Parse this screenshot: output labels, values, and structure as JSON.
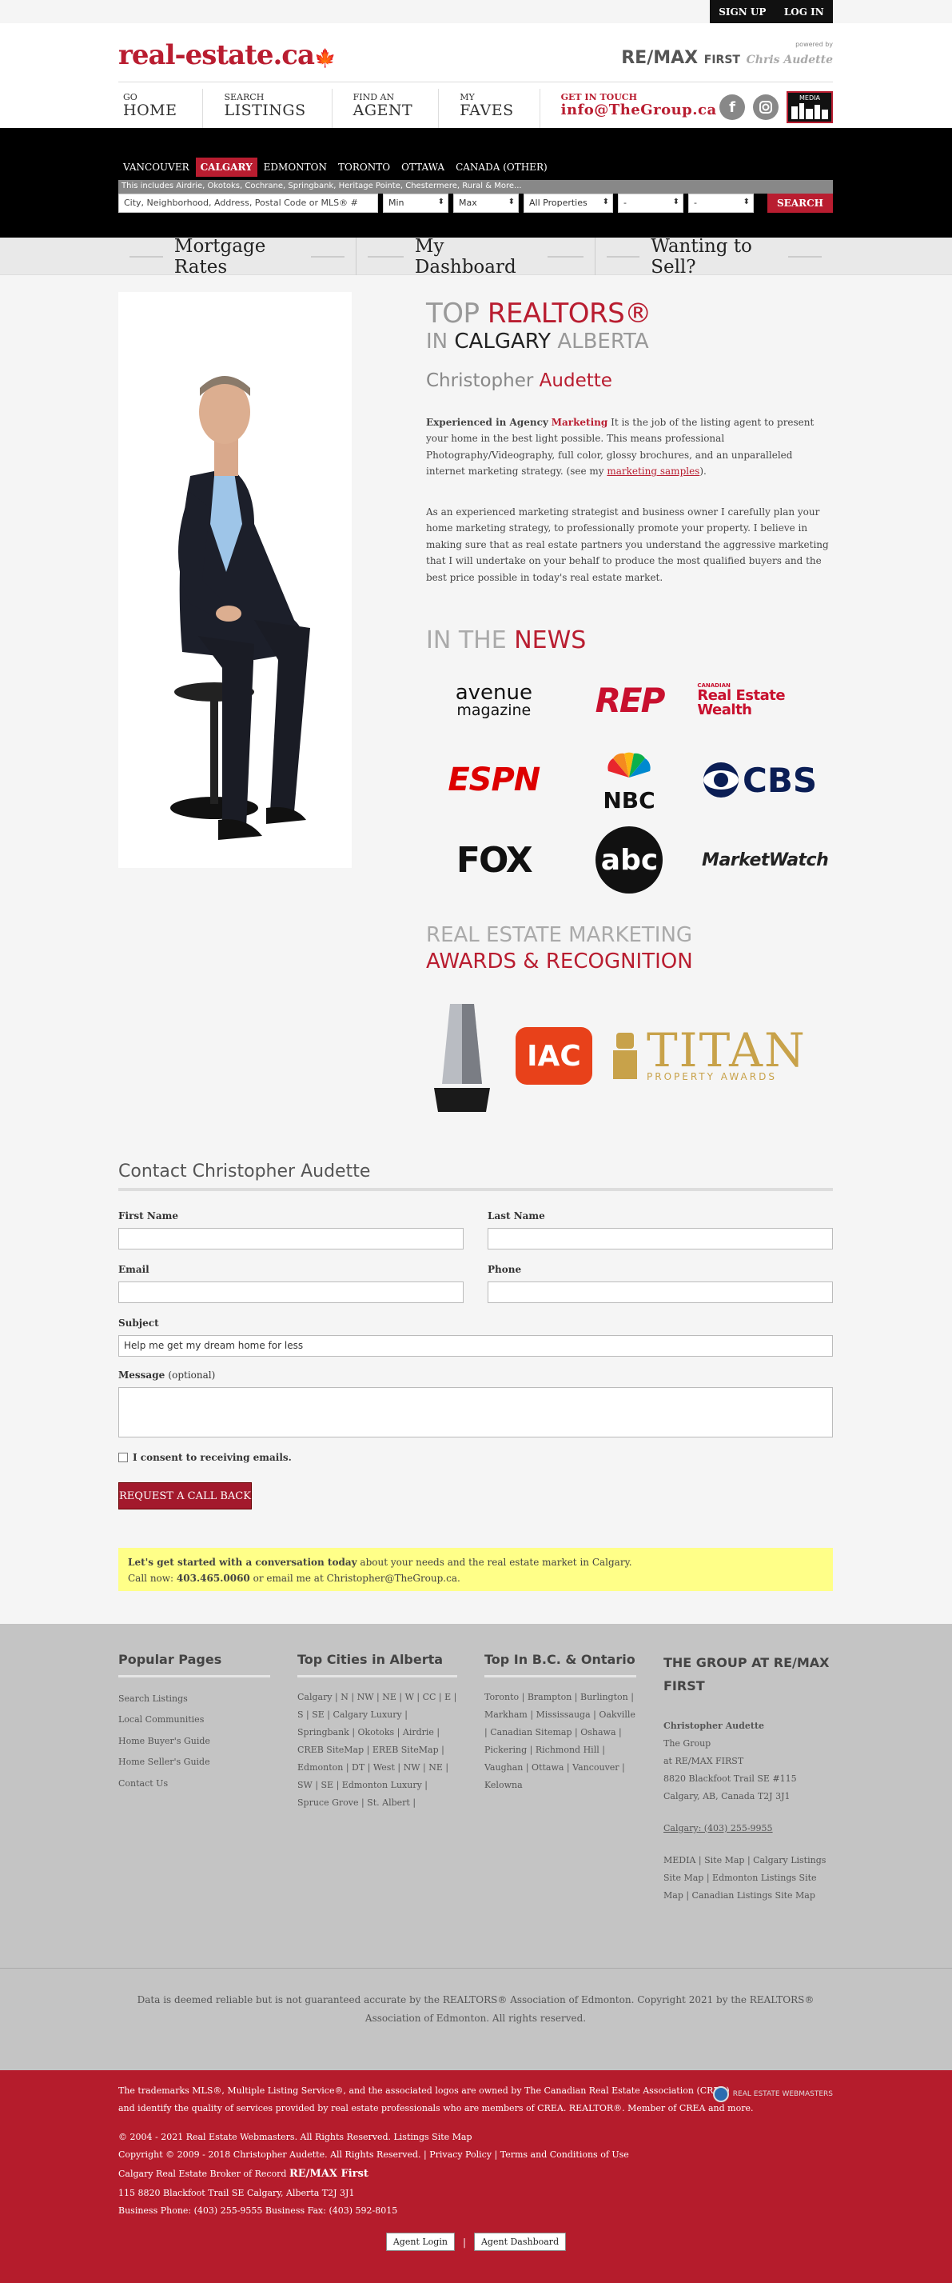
{
  "topbar": {
    "signup": "SIGN UP",
    "login": "LOG IN"
  },
  "header": {
    "logo": "real-estate.ca",
    "powered": "powered by",
    "brand": "RE/MAX",
    "brand_sub": "FIRST",
    "signature": "Chris Audette"
  },
  "nav": [
    {
      "small": "GO",
      "large": "HOME"
    },
    {
      "small": "SEARCH",
      "large": "LISTINGS"
    },
    {
      "small": "FIND AN",
      "large": "AGENT"
    },
    {
      "small": "MY",
      "large": "FAVES"
    }
  ],
  "contact_nav": {
    "small": "Get in Touch",
    "large": "info@TheGroup.ca"
  },
  "media_badge": "MEDIA",
  "cities": [
    "VANCOUVER",
    "CALGARY",
    "EDMONTON",
    "TORONTO",
    "OTTAWA",
    "CANADA (OTHER)"
  ],
  "search": {
    "hint": "This includes Airdrie, Okotoks, Cochrane, Springbank, Heritage Pointe, Chestermere, Rural & More...",
    "placeholder": "City, Neighborhood, Address, Postal Code or MLS® #",
    "min": "Min",
    "max": "Max",
    "type": "All Properties",
    "beds": "-",
    "baths": "-",
    "button": "SEARCH"
  },
  "subnav": [
    "Mortgage Rates",
    "My Dashboard",
    "Wanting to Sell?"
  ],
  "hero": {
    "top": "TOP",
    "realtors": "REALTORS®",
    "in": "IN",
    "city": "CALGARY",
    "province": "ALBERTA",
    "first": "Christopher",
    "last": "Audette"
  },
  "para1": {
    "lead": "Experienced in Agency",
    "lead_red": "Marketing",
    "body": " It is the job of the listing agent to present your home in the best light possible. This means professional Photography/Videography, full color, glossy brochures, and an unparalleled internet marketing strategy. (see my ",
    "link": "marketing samples",
    "end": ")."
  },
  "para2": "As an experienced marketing strategist and business owner I carefully plan your home marketing strategy, to professionally promote your property. I believe in making sure that as real estate partners you understand the aggressive marketing that I will undertake on your behalf to produce the most qualified buyers and the best price possible in today's real estate market.",
  "news": {
    "in_the": "IN THE",
    "news": "NEWS"
  },
  "news_logos": [
    "avenue",
    "magazine",
    "REP",
    "Real Estate Wealth",
    "ESPN",
    "NBC",
    "CBS",
    "FOX",
    "abc",
    "MarketWatch",
    "CANADIAN"
  ],
  "awards": {
    "line1": "REAL ESTATE MARKETING",
    "line2": "AWARDS & RECOGNITION",
    "iac": "IAC",
    "titan": "TITAN",
    "titan_sub": "PROPERTY AWARDS"
  },
  "contact": {
    "title": "Contact Christopher Audette",
    "first": "First Name",
    "last": "Last Name",
    "email": "Email",
    "phone": "Phone",
    "subject": "Subject",
    "subject_value": "Help me get my dream home for less",
    "message": "Message",
    "optional": "(optional)",
    "consent": "I consent to receiving emails.",
    "button": "REQUEST A CALL BACK"
  },
  "cta": {
    "bold": "Let's get started with a conversation today",
    "rest": " about your needs and the real estate market in Calgary.",
    "call": "Call now: ",
    "phone": "403.465.0060",
    "email": " or email me at Christopher@TheGroup.ca."
  },
  "footer": {
    "popular_title": "Popular Pages",
    "popular": [
      "Search Listings",
      "Local Communities",
      "Home Buyer's Guide",
      "Home Seller's Guide",
      "Contact Us"
    ],
    "alberta_title": "Top Cities in Alberta",
    "alberta": "Calgary | N | NW | NE | W | CC | E | S | SE | Calgary Luxury | Springbank | Okotoks | Airdrie | CREB SiteMap | EREB SiteMap | Edmonton | DT | West | NW | NE | SW | SE | Edmonton Luxury | Spruce Grove | St. Albert |",
    "bc_title": "Top In B.C. & Ontario",
    "bc": "Toronto | Brampton | Burlington | Markham | Mississauga | Oakville | Canadian Sitemap | Oshawa | Pickering | Richmond Hill | Vaughan | Ottawa | Vancouver | Kelowna",
    "group_title": "THE GROUP AT RE/MAX FIRST",
    "group_name": "Christopher Audette",
    "group_lines": [
      "The Group",
      "at RE/MAX FIRST",
      "8820 Blackfoot Trail SE #115",
      "Calgary, AB, Canada T2J 3J1"
    ],
    "group_phone": "Calgary: (403) 255-9955",
    "group_links": "MEDIA | Site Map | Calgary Listings Site Map | Edmonton Listings Site Map | Canadian Listings Site Map"
  },
  "disclaimer": "Data is deemed reliable but is not guaranteed accurate by the REALTORS® Association of Edmonton. Copyright 2021 by the REALTORS® Association of Edmonton. All rights reserved.",
  "red_footer": {
    "l1": "The trademarks MLS®, Multiple Listing Service®, and the associated logos are owned by The Canadian Real Estate Association (CREA)",
    "l2": "and identify the quality of services provided by real estate professionals who are members of CREA. REALTOR®. Member of CREA and more.",
    "l3": "© 2004 - 2021 Real Estate Webmasters. All Rights Reserved. Listings Site Map",
    "l4": "Copyright © 2009 - 2018 Christopher Audette. All Rights Reserved. | Privacy Policy | Terms and Conditions of Use",
    "l5": "Calgary Real Estate Broker of Record",
    "l5b": "RE/MAX First",
    "l6": "115 8820 Blackfoot Trail SE Calgary, Alberta T2J 3J1",
    "l7": "Business Phone: (403) 255-9555 Business Fax: (403) 592-8015",
    "wm": "REAL ESTATE WEBMASTERS",
    "agent_login": "Agent Login",
    "agent_dashboard": "Agent Dashboard"
  }
}
